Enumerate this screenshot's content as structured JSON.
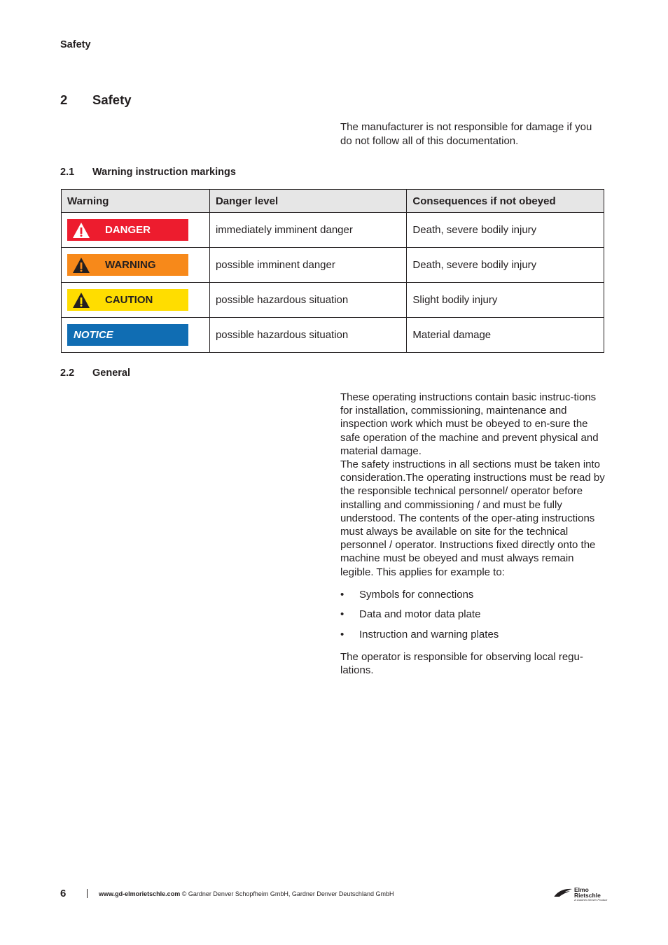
{
  "running_head": "Safety",
  "section": {
    "number": "2",
    "title": "Safety",
    "intro": "The manufacturer is not responsible for damage if you do not follow all of this documentation."
  },
  "subsection_1": {
    "number": "2.1",
    "title": "Warning instruction markings",
    "table": {
      "headers": [
        "Warning",
        "Danger level",
        "Consequences if not obeyed"
      ],
      "rows": [
        {
          "sign": "DANGER",
          "sign_color": "#ed1c2e",
          "level": "immediately imminent danger",
          "consequence": "Death, severe bodily injury"
        },
        {
          "sign": "WARNING",
          "sign_color": "#f7891a",
          "level": "possible imminent danger",
          "consequence": "Death, severe bodily injury"
        },
        {
          "sign": "CAUTION",
          "sign_color": "#ffdd00",
          "level": "possible hazardous situation",
          "consequence": "Slight bodily injury"
        },
        {
          "sign": "NOTICE",
          "sign_color": "#106db3",
          "level": "possible hazardous situation",
          "consequence": "Material damage"
        }
      ]
    }
  },
  "subsection_2": {
    "number": "2.2",
    "title": "General",
    "paragraph_1": "These operating instructions contain basic instruc-tions for installation, commissioning, maintenance and inspection work which must be obeyed to en-sure the safe operation of the machine and prevent physical and material damage.",
    "paragraph_2": "The safety instructions in all sections must be taken into consideration.The operating instructions must be read by the responsible technical personnel/ operator before installing and commissioning / and must be fully understood. The contents of the oper-ating instructions must always be available on site for the technical personnel / operator. Instructions fixed directly onto the machine must be obeyed and must always remain legible. This applies for example to:",
    "bullets": [
      "Symbols for connections",
      "Data and motor data plate",
      "Instruction and warning plates"
    ],
    "bullet_glyph": "•",
    "paragraph_3": "The operator is responsible for observing local regu-lations."
  },
  "footer": {
    "page_number": "6",
    "url": "www.gd-elmorietschle.com",
    "copyright": " © Gardner Denver Schopfheim GmbH, Gardner Denver Deutschland GmbH"
  },
  "logo": {
    "line1": "Elmo",
    "line2": "Rietschle",
    "tagline": "A Gardner Denver Product"
  }
}
